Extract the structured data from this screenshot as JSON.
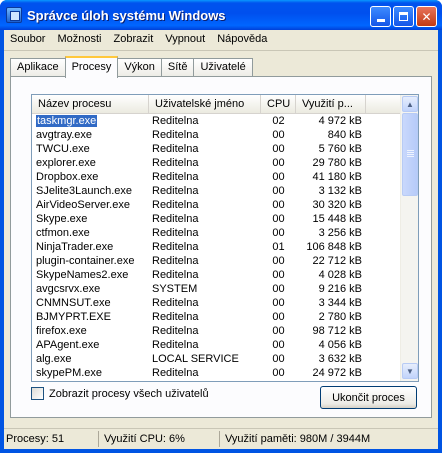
{
  "window": {
    "title": "Správce úloh systému Windows"
  },
  "menu": [
    "Soubor",
    "Možnosti",
    "Zobrazit",
    "Vypnout",
    "Nápověda"
  ],
  "tabs": [
    "Aplikace",
    "Procesy",
    "Výkon",
    "Sítě",
    "Uživatelé"
  ],
  "active_tab": "Procesy",
  "columns": [
    "Název procesu",
    "Uživatelské jméno",
    "CPU",
    "Využití p..."
  ],
  "processes": [
    {
      "name": "taskmgr.exe",
      "user": "Reditelna",
      "cpu": "02",
      "mem": "4 972 kB",
      "selected": true
    },
    {
      "name": "avgtray.exe",
      "user": "Reditelna",
      "cpu": "00",
      "mem": "840 kB"
    },
    {
      "name": "TWCU.exe",
      "user": "Reditelna",
      "cpu": "00",
      "mem": "5 760 kB"
    },
    {
      "name": "explorer.exe",
      "user": "Reditelna",
      "cpu": "00",
      "mem": "29 780 kB"
    },
    {
      "name": "Dropbox.exe",
      "user": "Reditelna",
      "cpu": "00",
      "mem": "41 180 kB"
    },
    {
      "name": "SJelite3Launch.exe",
      "user": "Reditelna",
      "cpu": "00",
      "mem": "3 132 kB"
    },
    {
      "name": "AirVideoServer.exe",
      "user": "Reditelna",
      "cpu": "00",
      "mem": "30 320 kB"
    },
    {
      "name": "Skype.exe",
      "user": "Reditelna",
      "cpu": "00",
      "mem": "15 448 kB"
    },
    {
      "name": "ctfmon.exe",
      "user": "Reditelna",
      "cpu": "00",
      "mem": "3 256 kB"
    },
    {
      "name": "NinjaTrader.exe",
      "user": "Reditelna",
      "cpu": "01",
      "mem": "106 848 kB"
    },
    {
      "name": "plugin-container.exe",
      "user": "Reditelna",
      "cpu": "00",
      "mem": "22 712 kB"
    },
    {
      "name": "SkypeNames2.exe",
      "user": "Reditelna",
      "cpu": "00",
      "mem": "4 028 kB"
    },
    {
      "name": "avgcsrvx.exe",
      "user": "SYSTEM",
      "cpu": "00",
      "mem": "9 216 kB"
    },
    {
      "name": "CNMNSUT.exe",
      "user": "Reditelna",
      "cpu": "00",
      "mem": "3 344 kB"
    },
    {
      "name": "BJMYPRT.EXE",
      "user": "Reditelna",
      "cpu": "00",
      "mem": "2 780 kB"
    },
    {
      "name": "firefox.exe",
      "user": "Reditelna",
      "cpu": "00",
      "mem": "98 712 kB"
    },
    {
      "name": "APAgent.exe",
      "user": "Reditelna",
      "cpu": "00",
      "mem": "4 056 kB"
    },
    {
      "name": "alg.exe",
      "user": "LOCAL SERVICE",
      "cpu": "00",
      "mem": "3 632 kB"
    },
    {
      "name": "skypePM.exe",
      "user": "Reditelna",
      "cpu": "00",
      "mem": "24 972 kB"
    }
  ],
  "show_all_users_label": "Zobrazit procesy všech uživatelů",
  "end_process_label": "Ukončit proces",
  "status": {
    "processes": "Procesy: 51",
    "cpu": "Využití CPU: 6%",
    "memory": "Využití paměti: 980M / 3944M"
  }
}
